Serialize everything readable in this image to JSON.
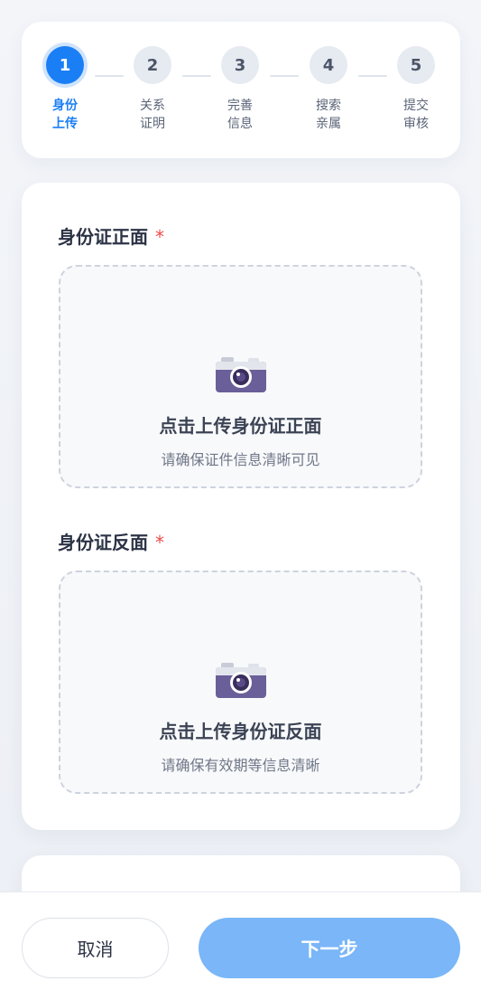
{
  "stepper": {
    "steps": [
      {
        "number": "1",
        "label": "身份上传",
        "active": true
      },
      {
        "number": "2",
        "label": "关系证明",
        "active": false
      },
      {
        "number": "3",
        "label": "完善信息",
        "active": false
      },
      {
        "number": "4",
        "label": "搜索亲属",
        "active": false
      },
      {
        "number": "5",
        "label": "提交审核",
        "active": false
      }
    ]
  },
  "front": {
    "title": "身份证正面",
    "required_mark": "*",
    "icon": "camera-icon",
    "upload_label": "点击上传身份证正面",
    "hint": "请确保证件信息清晰可见"
  },
  "back": {
    "title": "身份证反面",
    "required_mark": "*",
    "icon": "camera-icon",
    "upload_label": "点击上传身份证反面",
    "hint": "请确保有效期等信息清晰"
  },
  "footer": {
    "cancel_label": "取消",
    "next_label": "下一步"
  },
  "colors": {
    "primary": "#1a7ff5",
    "primary_disabled": "#7ab6f8",
    "required": "#ef4a4a"
  }
}
